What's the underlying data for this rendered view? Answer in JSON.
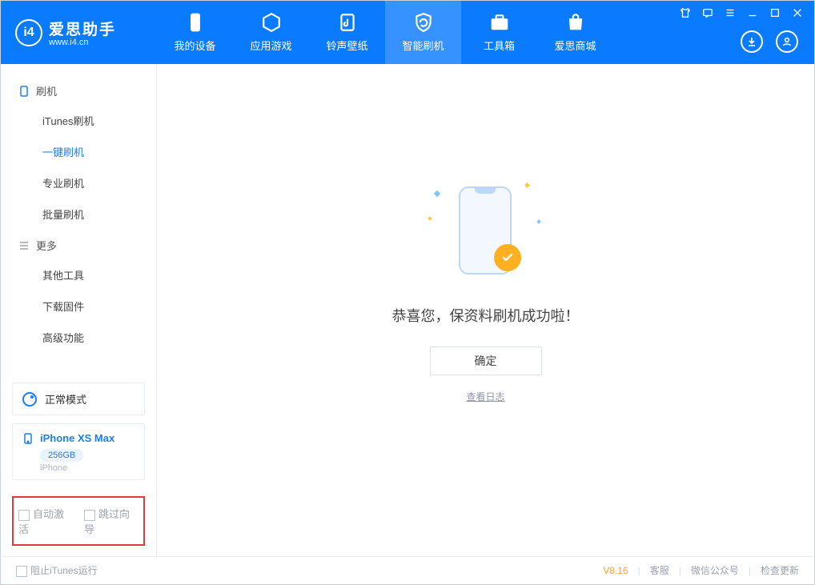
{
  "app": {
    "name": "爱思助手",
    "domain": "www.i4.cn"
  },
  "nav": {
    "tabs": [
      "我的设备",
      "应用游戏",
      "铃声壁纸",
      "智能刷机",
      "工具箱",
      "爱思商城"
    ],
    "activeIndex": 3
  },
  "sidebar": {
    "section1": {
      "title": "刷机",
      "items": [
        "iTunes刷机",
        "一键刷机",
        "专业刷机",
        "批量刷机"
      ],
      "activeIndex": 1
    },
    "section2": {
      "title": "更多",
      "items": [
        "其他工具",
        "下载固件",
        "高级功能"
      ]
    }
  },
  "mode": {
    "label": "正常模式"
  },
  "device": {
    "name": "iPhone XS Max",
    "capacity": "256GB",
    "type": "iPhone"
  },
  "options": {
    "autoActivate": "自动激活",
    "skipGuide": "跳过向导"
  },
  "main": {
    "message": "恭喜您，保资料刷机成功啦！",
    "okLabel": "确定",
    "logLink": "查看日志"
  },
  "footer": {
    "blockItunes": "阻止iTunes运行",
    "version": "V8.16",
    "links": [
      "客服",
      "微信公众号",
      "检查更新"
    ]
  }
}
